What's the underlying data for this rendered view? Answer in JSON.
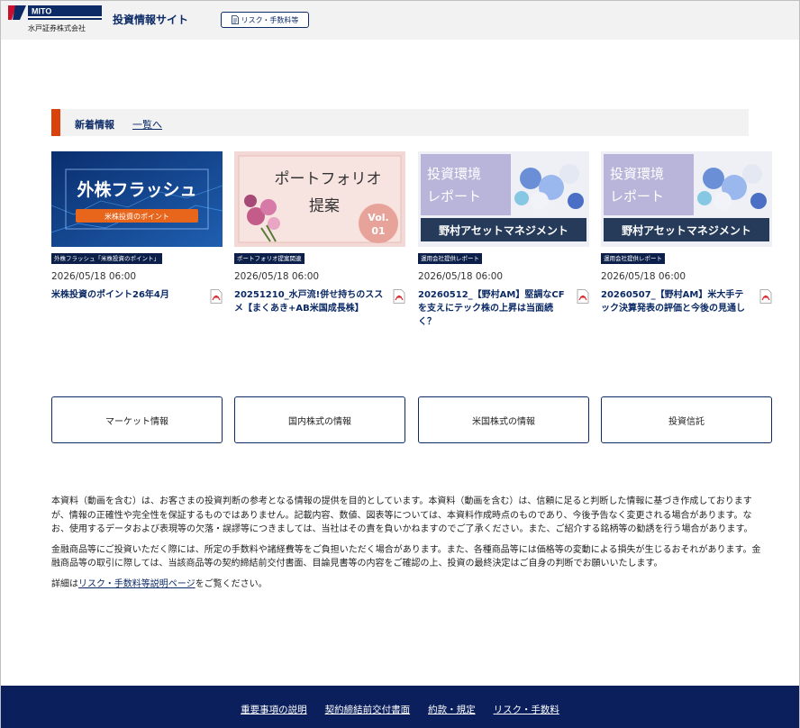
{
  "header": {
    "logo_text": "MITO",
    "company_name": "水戸証券株式会社",
    "site_title": "投資情報サイト",
    "risk_button_label": "リスク・手数料等"
  },
  "news": {
    "section_label": "新着情報",
    "more_link": "一覧へ",
    "items": [
      {
        "thumb_title": "外株フラッシュ",
        "thumb_subtitle": "米株投資のポイント",
        "tag": "外株フラッシュ「米株投資のポイント」",
        "date": "2026/05/18 06:00",
        "title": "米株投資のポイント26年4月"
      },
      {
        "thumb_title_line1": "ポートフォリオ",
        "thumb_title_line2": "提案",
        "thumb_vol": "Vol.",
        "thumb_vol_num": "01",
        "tag": "ポートフォリオ提案関連",
        "date": "2026/05/18 06:00",
        "title": "20251210_水戸流!併せ持ちのススメ【まくあき+AB米国成長株】"
      },
      {
        "thumb_title_line1": "投資環境",
        "thumb_title_line2": "レポート",
        "thumb_banner": "野村アセットマネジメント",
        "tag": "運用会社提供レポート",
        "date": "2026/05/18 06:00",
        "title": "20260512_【野村AM】堅調なCFを支えにテック株の上昇は当面続く？"
      },
      {
        "thumb_title_line1": "投資環境",
        "thumb_title_line2": "レポート",
        "thumb_banner": "野村アセットマネジメント",
        "tag": "運用会社提供レポート",
        "date": "2026/05/18 06:00",
        "title": "20260507_【野村AM】米大手テック決算発表の評価と今後の見通し"
      }
    ]
  },
  "categories": [
    {
      "label": "マーケット情報"
    },
    {
      "label": "国内株式の情報"
    },
    {
      "label": "米国株式の情報"
    },
    {
      "label": "投資信託"
    }
  ],
  "disclaimer": {
    "p1": "本資料（動画を含む）は、お客さまの投資判断の参考となる情報の提供を目的としています。本資料（動画を含む）は、信頼に足ると判断した情報に基づき作成しておりますが、情報の正確性や完全性を保証するものではありません。記載内容、数値、図表等については、本資料作成時点のものであり、今後予告なく変更される場合があります。なお、使用するデータおよび表現等の欠落・誤謬等につきましては、当社はその責を負いかねますのでご了承ください。また、ご紹介する銘柄等の勧誘を行う場合があります。",
    "p2": "金融商品等にご投資いただく際には、所定の手数料や諸経費等をご負担いただく場合があります。また、各種商品等には価格等の変動による損失が生じるおそれがあります。金融商品等の取引に際しては、当該商品等の契約締結前交付書面、目論見書等の内容をご確認の上、投資の最終決定はご自身の判断でお願いいたします。",
    "p3_prefix": "詳細は",
    "p3_link": "リスク・手数料等説明ページ",
    "p3_suffix": "をご覧ください。"
  },
  "footer": {
    "links": [
      "重要事項の説明",
      "契約締結前交付書面",
      "約款・規定",
      "リスク・手数料"
    ]
  },
  "colors": {
    "navy": "#0b2a66",
    "accent": "#d9420b",
    "footer_bg": "#0b1f5c"
  }
}
